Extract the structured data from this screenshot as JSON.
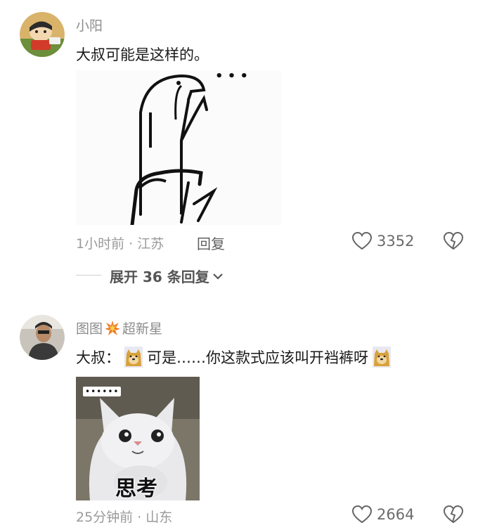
{
  "comments": [
    {
      "username": "小阳",
      "text": "大叔可能是这样的。",
      "time_location": "1小时前 · 江苏",
      "reply_label": "回复",
      "likes": "3352",
      "sticker_dots": "• • •"
    },
    {
      "username": "图图",
      "username_badge": "超新星",
      "text_prefix": "大叔：",
      "text_main": "可是……你这款式应该叫开裆裤呀",
      "time_location": "25分钟前 · 山东",
      "likes": "2664",
      "sticker_caption": "思考",
      "sticker_dots": "••••••"
    }
  ],
  "expand_replies": "展开 36 条回复"
}
